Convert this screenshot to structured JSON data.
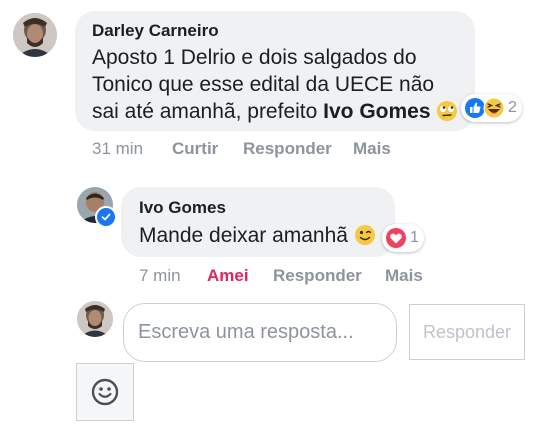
{
  "comment1": {
    "author": "Darley Carneiro",
    "text_line1": "Aposto 1 Delrio e dois salgados do",
    "text_line2": "Tonico que esse edital da UECE não",
    "text_line3_prefix": "sai até amanhã, prefeito ",
    "mention": "Ivo Gomes",
    "reaction_count": "2",
    "time": "31 min",
    "like_label": "Curtir",
    "reply_label": "Responder",
    "more_label": "Mais"
  },
  "comment2": {
    "author": "Ivo Gomes",
    "text": "Mande deixar amanhã ",
    "reaction_count": "1",
    "time": "7 min",
    "reacted_label": "Amei",
    "reply_label": "Responder",
    "more_label": "Mais"
  },
  "composer": {
    "placeholder": "Escreva uma resposta...",
    "submit_label": "Responder"
  },
  "colors": {
    "bubble": "#eff1f3",
    "meta": "#8d949e",
    "love": "#e0245e",
    "brand": "#1877f2"
  },
  "icons": [
    "rolling-eyes-emoji-icon",
    "like-reaction-icon",
    "haha-reaction-icon",
    "wink-emoji-icon",
    "love-reaction-icon",
    "verified-badge-icon",
    "smiley-icon"
  ]
}
